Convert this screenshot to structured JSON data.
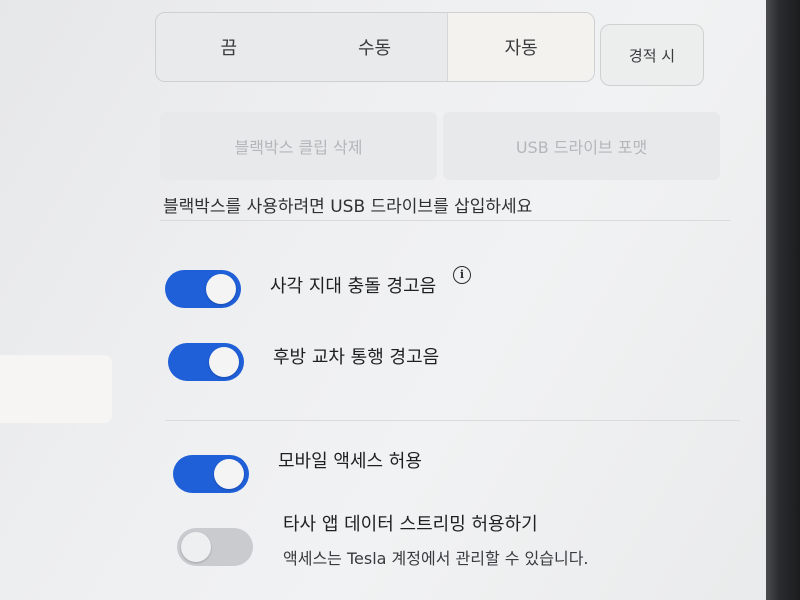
{
  "mode_selector": {
    "options": [
      "끔",
      "수동",
      "자동"
    ],
    "selected": "자동",
    "extra_option": "경적 시"
  },
  "dashcam_actions": {
    "delete_clips": "블랙박스 클립 삭제",
    "format_usb": "USB 드라이브 포맷"
  },
  "usb_notice": "블랙박스를 사용하려면 USB 드라이브를 삽입하세요",
  "toggles": [
    {
      "label": "사각 지대 충돌 경고음",
      "state": "on",
      "has_info_icon": true
    },
    {
      "label": "후방 교차 통행 경고음",
      "state": "on"
    },
    {
      "label": "모바일 액세스 허용",
      "state": "on"
    },
    {
      "label": "타사 앱 데이터 스트리밍 허용하기",
      "state": "off",
      "sublabel": "액세스는 Tesla 계정에서 관리할 수 있습니다."
    }
  ],
  "icons": {
    "info": "info-icon",
    "info_glyph": "i"
  },
  "colors": {
    "toggle_on": "#1f5fd8",
    "toggle_off": "#c9cbcf",
    "disabled_text": "#b4b6b9"
  }
}
